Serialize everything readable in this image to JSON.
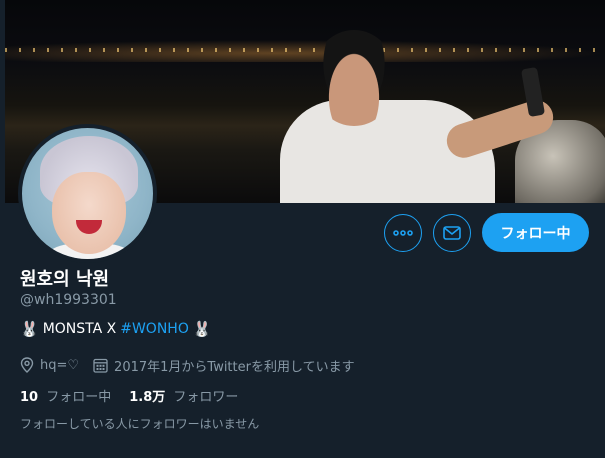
{
  "profile": {
    "display_name": "원호의 낙원",
    "handle": "@wh1993301",
    "bio": {
      "prefix_emoji": "🐰",
      "text": "MONSTA X ",
      "hashtag": "#WONHO",
      "suffix_emoji": "🐰"
    },
    "location": "hq=♡",
    "joined": "2017年1月からTwitterを利用しています"
  },
  "actions": {
    "more_icon": "more-dots-icon",
    "message_icon": "mail-icon",
    "follow_label": "フォロー中"
  },
  "stats": {
    "following_count": "10",
    "following_label": "フォロー中",
    "followers_count": "1.8万",
    "followers_label": "フォロワー"
  },
  "followers_note": "フォローしている人にフォロワーはいません",
  "colors": {
    "background": "#15202b",
    "accent": "#1da1f2",
    "secondary_text": "#8899a6"
  }
}
